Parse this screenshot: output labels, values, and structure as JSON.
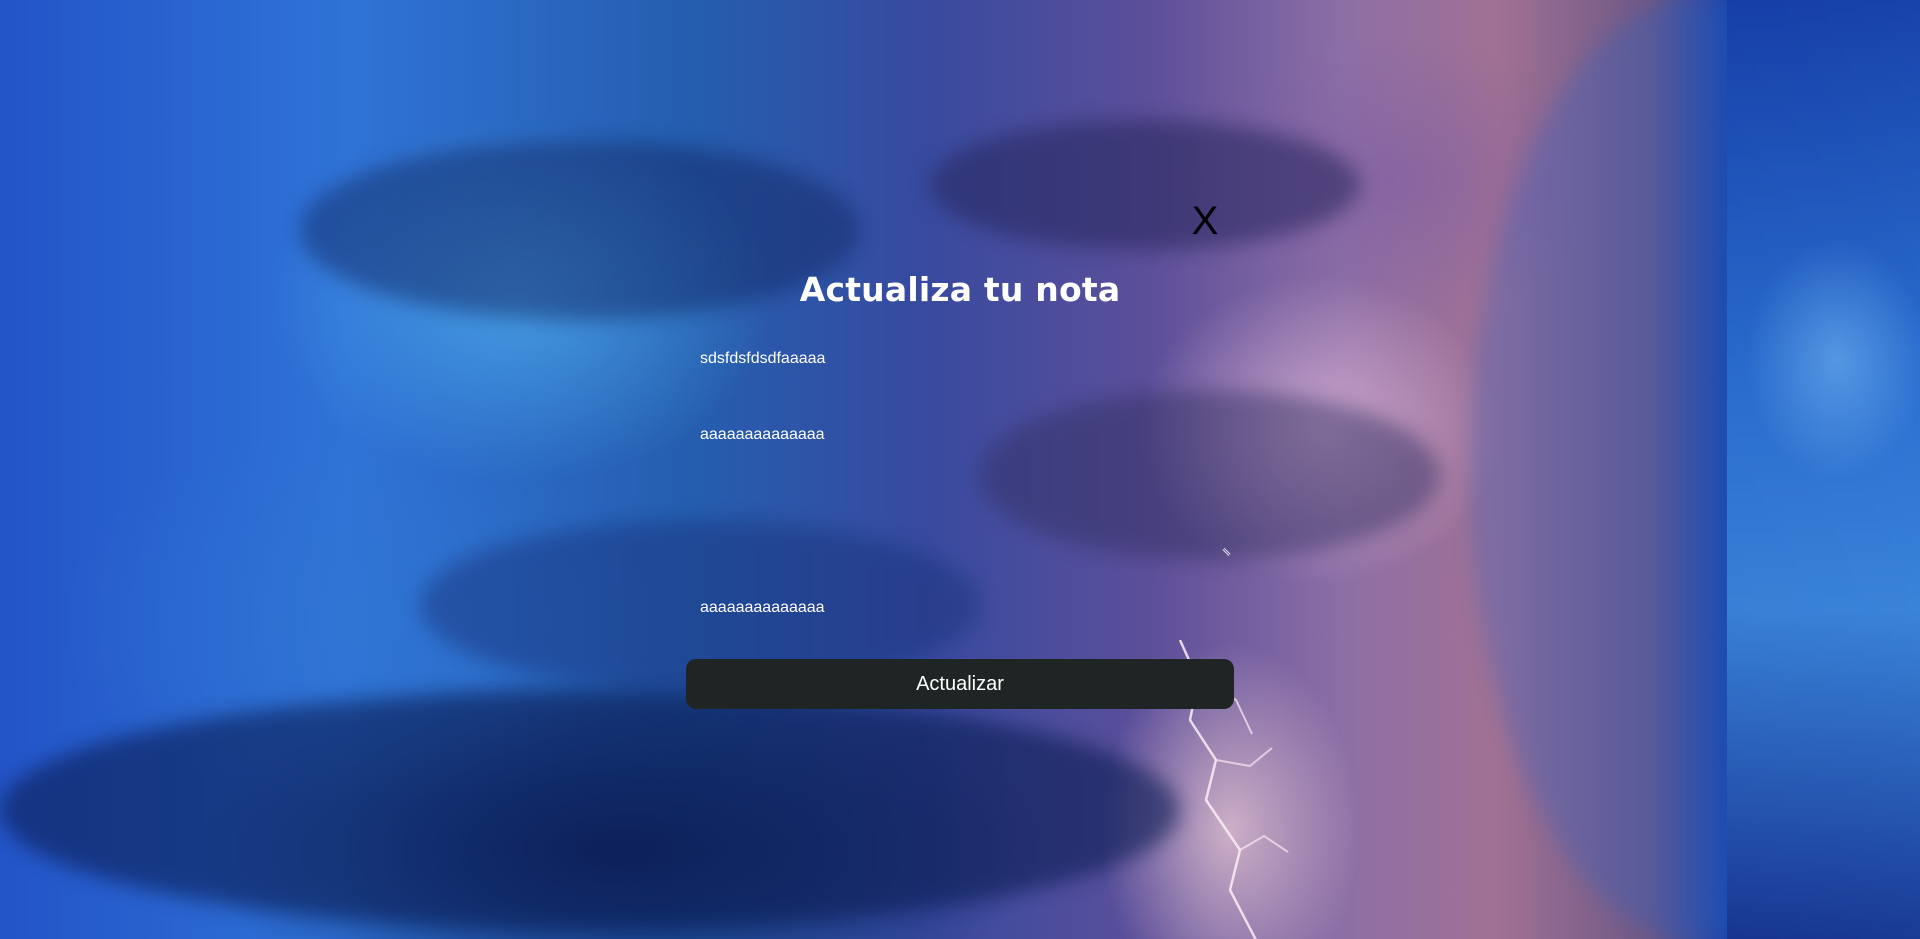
{
  "modal": {
    "close_label": "X",
    "title": "Actualiza tu nota",
    "fields": {
      "title_value": "sdsfdsfdsdfaaaaa",
      "description_value": "aaaaaaaaaaaaaa",
      "extra_value": "aaaaaaaaaaaaaa"
    },
    "submit_label": "Actualizar"
  },
  "icons": {
    "close": "close-icon",
    "resize": "resize-handle-icon"
  },
  "colors": {
    "button_background": "#1f2524",
    "title_text": "#ffffff",
    "close_text": "#000000"
  }
}
